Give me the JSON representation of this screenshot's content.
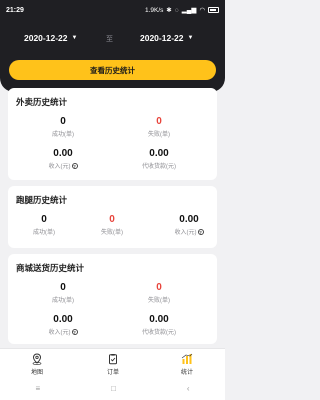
{
  "status": {
    "time": "21:29",
    "net_speed": "1.9K/s",
    "battery_icon": "battery-icon"
  },
  "filter": {
    "start_date": "2020-12-22",
    "separator": "至",
    "end_date": "2020-12-22",
    "query_button": "查看历史统计"
  },
  "takeout": {
    "title": "外卖历史统计",
    "success_value": "0",
    "success_label": "成功(单)",
    "fail_value": "0",
    "fail_label": "失败(单)",
    "income_value": "0.00",
    "income_label": "收入(元)",
    "cod_value": "0.00",
    "cod_label": "代收货款(元)"
  },
  "errand": {
    "title": "跑腿历史统计",
    "success_value": "0",
    "success_label": "成功(单)",
    "fail_value": "0",
    "fail_label": "失败(单)",
    "income_value": "0.00",
    "income_label": "收入(元)"
  },
  "mall": {
    "title": "商城送货历史统计",
    "success_value": "0",
    "success_label": "成功(单)",
    "fail_value": "0",
    "fail_label": "失败(单)",
    "income_value": "0.00",
    "income_label": "收入(元)",
    "cod_value": "0.00",
    "cod_label": "代收货款(元)"
  },
  "nav": {
    "map": "地图",
    "orders": "订单",
    "stats": "统计"
  },
  "sys_nav": {
    "menu": "≡",
    "home": "□",
    "back": "‹"
  },
  "colors": {
    "header_bg": "#1f1f23",
    "accent": "#ffc21a",
    "fail_red": "#e8453c"
  }
}
